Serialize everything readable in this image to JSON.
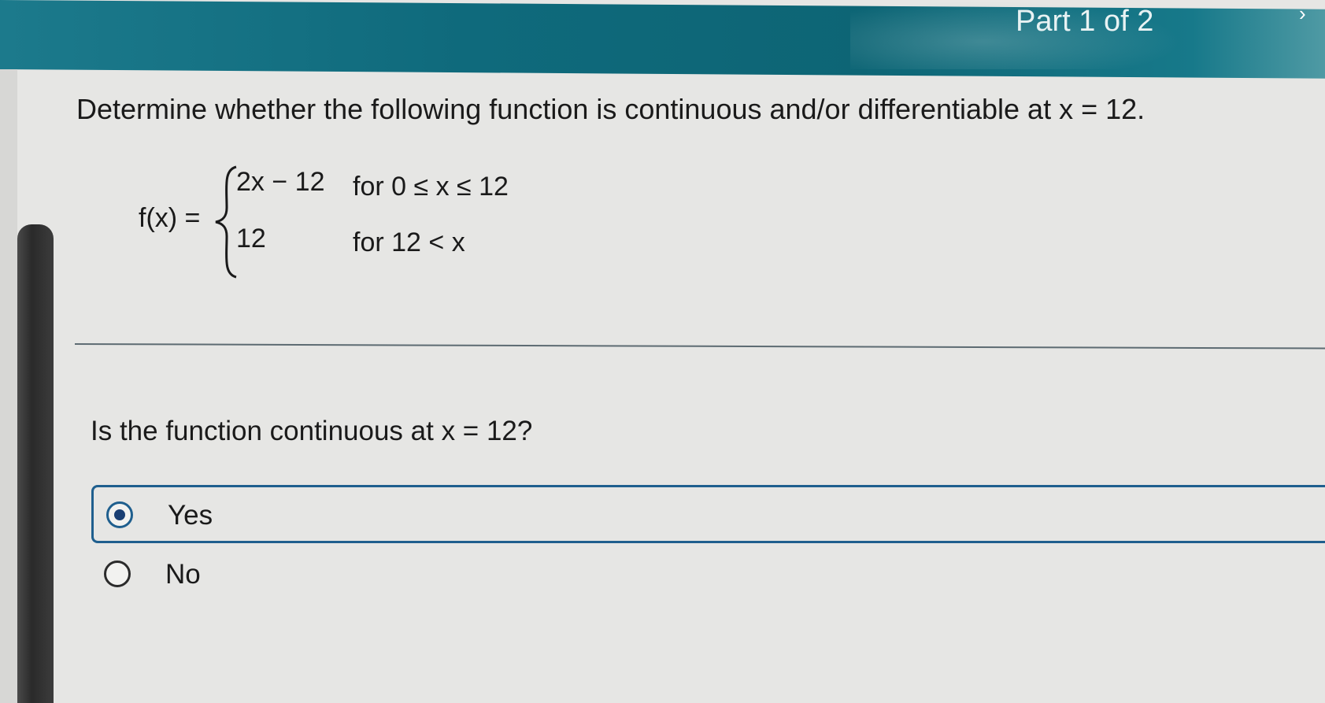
{
  "header": {
    "part_label": "Part 1 of 2"
  },
  "problem": {
    "question": "Determine whether the following function is continuous and/or differentiable at x = 12.",
    "function_label": "f(x) =",
    "cases": [
      {
        "expression": "2x − 12",
        "condition": "for 0 ≤ x  ≤ 12"
      },
      {
        "expression": "12",
        "condition": "for 12 < x"
      }
    ]
  },
  "part1": {
    "question": "Is the function continuous at x = 12?",
    "options": [
      {
        "label": "Yes",
        "selected": true
      },
      {
        "label": "No",
        "selected": false
      }
    ]
  },
  "colors": {
    "header": "#0f6a7c",
    "selection_border": "#1f5f8e",
    "radio_dot": "#1a3f73"
  },
  "icons": {
    "header_chevron": "chevron-right-icon"
  }
}
